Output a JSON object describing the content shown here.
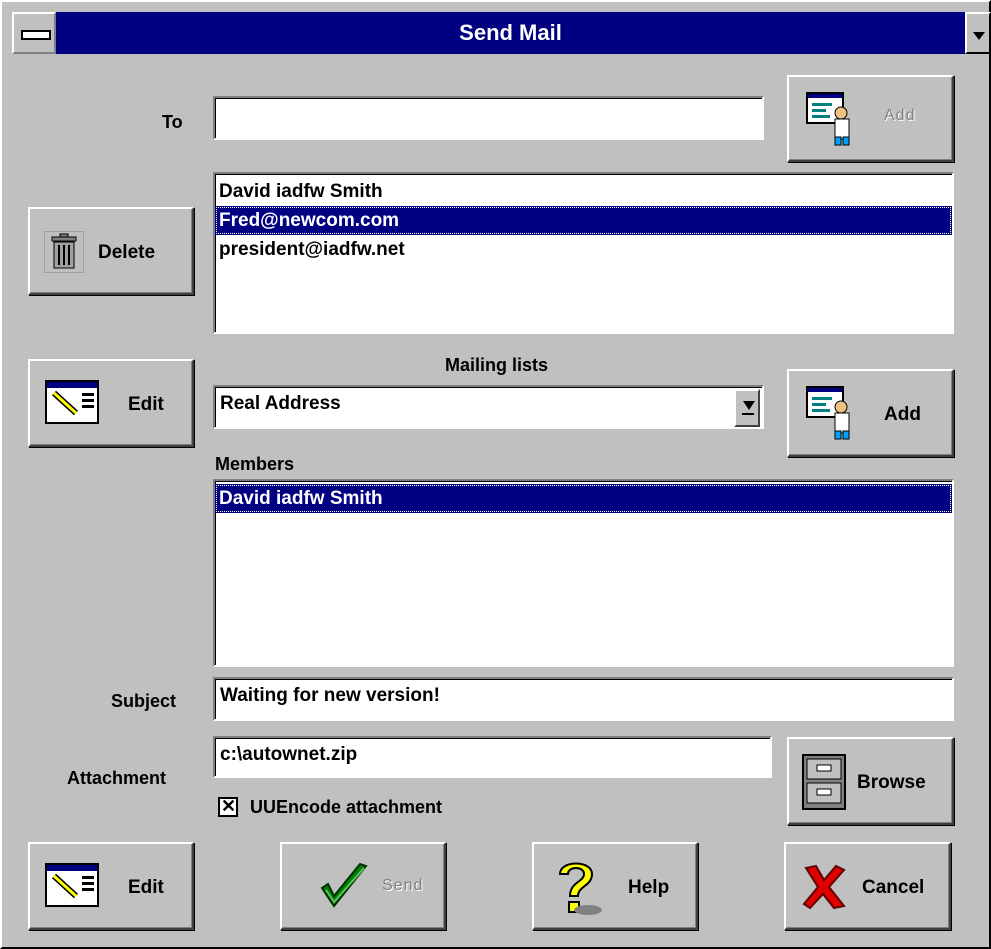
{
  "window": {
    "title": "Send Mail"
  },
  "to": {
    "label": "To",
    "value": ""
  },
  "add_recipient": {
    "label": "Add",
    "icon": "address-book-person-icon"
  },
  "delete_button": {
    "label": "Delete",
    "icon": "trash-can-icon"
  },
  "recipients": [
    {
      "text": "David iadfw Smith",
      "selected": false
    },
    {
      "text": "Fred@newcom.com",
      "selected": true
    },
    {
      "text": "president@iadfw.net",
      "selected": false
    }
  ],
  "mailing_lists": {
    "label": "Mailing lists",
    "selected": "Real Address"
  },
  "edit_lists_button": {
    "label": "Edit",
    "icon": "edit-window-icon"
  },
  "add_list_button": {
    "label": "Add",
    "icon": "address-book-person-icon"
  },
  "members": {
    "label": "Members",
    "items": [
      {
        "text": "David iadfw Smith",
        "selected": true
      }
    ]
  },
  "subject": {
    "label": "Subject",
    "value": "Waiting for new version!"
  },
  "attachment": {
    "label": "Attachment",
    "value": "c:\\autownet.zip"
  },
  "browse_button": {
    "label": "Browse",
    "icon": "file-cabinet-icon"
  },
  "uuencode": {
    "label": "UUEncode attachment",
    "checked": true
  },
  "bottom": {
    "edit": {
      "label": "Edit",
      "icon": "edit-window-icon"
    },
    "send": {
      "label": "Send",
      "icon": "checkmark-icon"
    },
    "help": {
      "label": "Help",
      "icon": "question-mark-icon"
    },
    "cancel": {
      "label": "Cancel",
      "icon": "red-x-icon"
    }
  }
}
